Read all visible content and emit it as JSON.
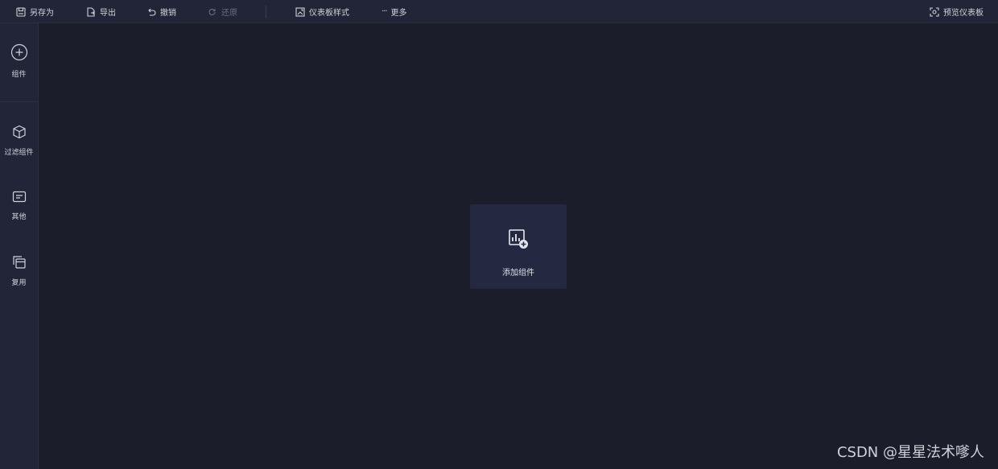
{
  "toolbar": {
    "save_as": "另存为",
    "export": "导出",
    "undo": "撤销",
    "redo": "还原",
    "dashboard_style": "仪表板样式",
    "more": "更多",
    "preview": "预览仪表板"
  },
  "sidebar": {
    "items": [
      {
        "label": "组件",
        "icon": "plus-circle-icon"
      },
      {
        "label": "过滤组件",
        "icon": "cube-icon"
      },
      {
        "label": "其他",
        "icon": "message-box-icon"
      },
      {
        "label": "复用",
        "icon": "copy-layers-icon"
      }
    ]
  },
  "canvas": {
    "add_component_label": "添加组件",
    "add_component_icon": "chart-add-icon"
  },
  "watermark": "CSDN @星星法术嗲人",
  "colors": {
    "background": "#1b1d2b",
    "panel": "#222538",
    "card": "#242840",
    "text": "#d0d2da",
    "disabled_text": "#6a6d80"
  }
}
